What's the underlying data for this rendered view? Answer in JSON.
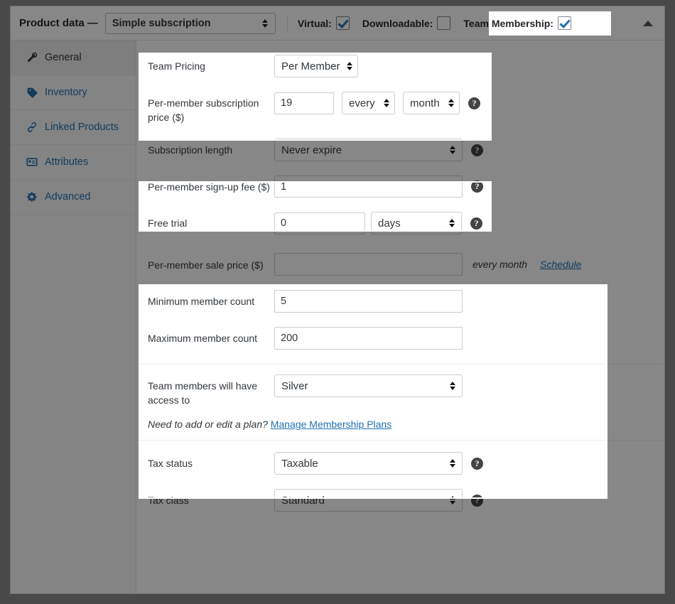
{
  "header": {
    "title": "Product data —",
    "product_type": "Simple subscription",
    "virtual_label": "Virtual:",
    "virtual_checked": true,
    "downloadable_label": "Downloadable:",
    "downloadable_checked": false,
    "team_membership_label": "Team Membership:",
    "team_membership_checked": true,
    "collapse_icon": "triangle-up-icon"
  },
  "sidebar": {
    "items": [
      {
        "label": "General",
        "icon": "wrench-icon",
        "active": true
      },
      {
        "label": "Inventory",
        "icon": "tag-icon",
        "active": false
      },
      {
        "label": "Linked Products",
        "icon": "link-icon",
        "active": false
      },
      {
        "label": "Attributes",
        "icon": "attributes-icon",
        "active": false
      },
      {
        "label": "Advanced",
        "icon": "gear-icon",
        "active": false
      }
    ]
  },
  "form": {
    "team_pricing": {
      "label": "Team Pricing",
      "value": "Per Member"
    },
    "per_member_price": {
      "label": "Per-member subscription price ($)",
      "amount": "19",
      "every": "every",
      "period": "month",
      "help": "?"
    },
    "subscription_length": {
      "label": "Subscription length",
      "value": "Never expire",
      "help": "?"
    },
    "signup_fee": {
      "label": "Per-member sign-up fee ($)",
      "value": "1",
      "help": "?"
    },
    "free_trial": {
      "label": "Free trial",
      "value": "0",
      "period": "days",
      "help": "?"
    },
    "sale_price": {
      "label": "Per-member sale price ($)",
      "value": "",
      "suffix": "every month",
      "schedule_link": "Schedule"
    },
    "min_members": {
      "label": "Minimum member count",
      "value": "5"
    },
    "max_members": {
      "label": "Maximum member count",
      "value": "200"
    },
    "access_plan": {
      "label": "Team members will have access to",
      "value": "Silver"
    },
    "plan_note": {
      "text": "Need to add or edit a plan?",
      "link": "Manage Membership Plans"
    },
    "tax_status": {
      "label": "Tax status",
      "value": "Taxable",
      "help": "?"
    },
    "tax_class": {
      "label": "Tax class",
      "value": "Standard",
      "help": "?"
    }
  },
  "colors": {
    "accent": "#2271b1",
    "dim": "#808080",
    "highlight_border": "#ffffff"
  }
}
